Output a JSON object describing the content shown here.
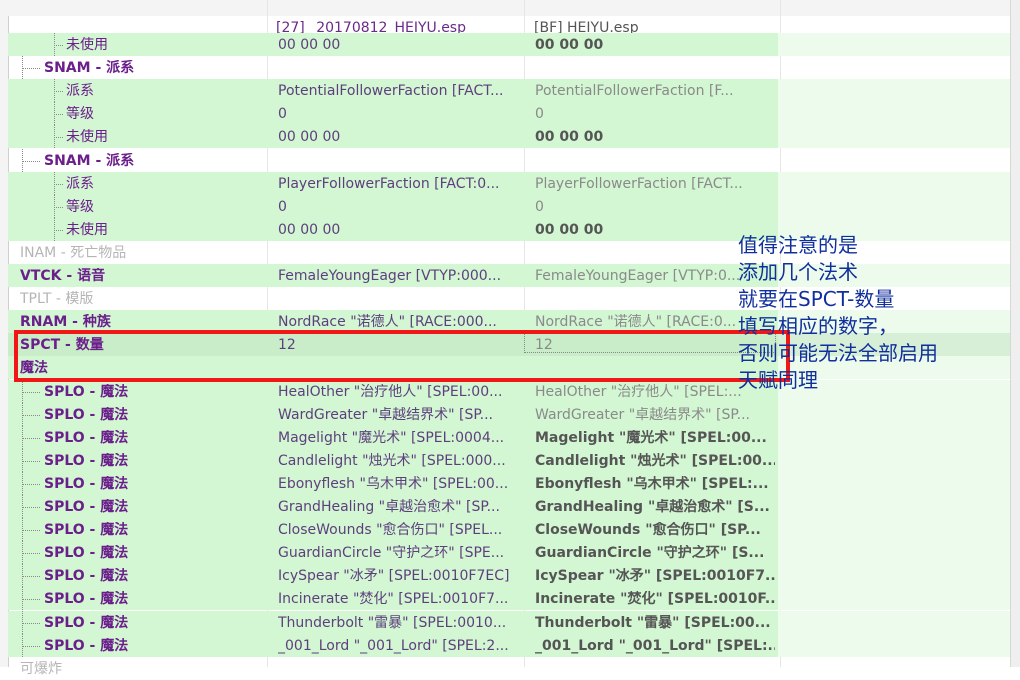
{
  "header": {
    "col1": "[27] _20170812_HEIYU.esp",
    "col2": "[BF] HEIYU.esp"
  },
  "rows": [
    {
      "type": "sub",
      "label": "未使用",
      "v1": "00 00 00",
      "v2": "00 00 00",
      "v2style": "v2b",
      "green": true
    },
    {
      "type": "name",
      "label": "SNAM - 派系",
      "v1": "",
      "v2": "",
      "green": false
    },
    {
      "type": "sub",
      "label": "派系",
      "v1": "PotentialFollowerFaction [FACT...",
      "v2": "PotentialFollowerFaction [F...",
      "v2style": "v2",
      "green": true
    },
    {
      "type": "sub",
      "label": "等级",
      "v1": "0",
      "v2": "0",
      "v2style": "v2",
      "green": true
    },
    {
      "type": "sub",
      "label": "未使用",
      "v1": "00 00 00",
      "v2": "00 00 00",
      "v2style": "v2b",
      "green": true
    },
    {
      "type": "name",
      "label": "SNAM - 派系",
      "v1": "",
      "v2": "",
      "green": false
    },
    {
      "type": "sub",
      "label": "派系",
      "v1": "PlayerFollowerFaction [FACT:0...",
      "v2": "PlayerFollowerFaction [FACT...",
      "v2style": "v2",
      "green": true
    },
    {
      "type": "sub",
      "label": "等级",
      "v1": "0",
      "v2": "0",
      "v2style": "v2",
      "green": true
    },
    {
      "type": "sub",
      "label": "未使用",
      "v1": "00 00 00",
      "v2": "00 00 00",
      "v2style": "v2b",
      "green": true
    },
    {
      "type": "dim",
      "label": "INAM - 死亡物品",
      "v1": "",
      "v2": "",
      "green": false
    },
    {
      "type": "top",
      "label": "VTCK - 语音",
      "v1": "FemaleYoungEager [VTYP:000...",
      "v2": "FemaleYoungEager [VTYP:0...",
      "v2style": "v2",
      "green": true
    },
    {
      "type": "dim",
      "label": "TPLT - 模版",
      "v1": "",
      "v2": "",
      "green": false
    },
    {
      "type": "top",
      "label": "RNAM - 种族",
      "v1": "NordRace \"诺德人\" [RACE:000...",
      "v2": "NordRace \"诺德人\" [RACE:0...",
      "v2style": "v2",
      "green": true
    },
    {
      "type": "top",
      "label": "SPCT - 数量",
      "v1": "12",
      "v2": "12",
      "v2style": "v2",
      "green": true,
      "spct": true
    },
    {
      "type": "top",
      "label": "魔法",
      "v1": "",
      "v2": "",
      "green": true
    },
    {
      "type": "name",
      "label": "SPLO - 魔法",
      "v1": "HealOther \"治疗他人\" [SPEL:00...",
      "v2": "HealOther \"治疗他人\" [SPEL:...",
      "v2style": "v2",
      "green": true
    },
    {
      "type": "name",
      "label": "SPLO - 魔法",
      "v1": "WardGreater \"卓越结界术\" [SP...",
      "v2": "WardGreater \"卓越结界术\" [SP...",
      "v2style": "v2",
      "green": true
    },
    {
      "type": "name",
      "label": "SPLO - 魔法",
      "v1": "Magelight \"魔光术\" [SPEL:0004...",
      "v2": "Magelight \"魔光术\" [SPEL:00...",
      "v2style": "v2b",
      "green": true
    },
    {
      "type": "name",
      "label": "SPLO - 魔法",
      "v1": "Candlelight \"烛光术\" [SPEL:000...",
      "v2": "Candlelight \"烛光术\" [SPEL:00...",
      "v2style": "v2b",
      "green": true
    },
    {
      "type": "name",
      "label": "SPLO - 魔法",
      "v1": "Ebonyflesh \"乌木甲术\" [SPEL:00...",
      "v2": "Ebonyflesh \"乌木甲术\" [SPEL:...",
      "v2style": "v2b",
      "green": true
    },
    {
      "type": "name",
      "label": "SPLO - 魔法",
      "v1": "GrandHealing \"卓越治愈术\" [SP...",
      "v2": "GrandHealing \"卓越治愈术\" [S...",
      "v2style": "v2b",
      "green": true
    },
    {
      "type": "name",
      "label": "SPLO - 魔法",
      "v1": "CloseWounds \"愈合伤口\" [SPEL...",
      "v2": "CloseWounds \"愈合伤口\" [SP...",
      "v2style": "v2b",
      "green": true
    },
    {
      "type": "name",
      "label": "SPLO - 魔法",
      "v1": "GuardianCircle \"守护之环\" [SPE...",
      "v2": "GuardianCircle \"守护之环\" [S...",
      "v2style": "v2b",
      "green": true
    },
    {
      "type": "name",
      "label": "SPLO - 魔法",
      "v1": "IcySpear \"冰矛\" [SPEL:0010F7EC]",
      "v2": "IcySpear \"冰矛\" [SPEL:0010F7...",
      "v2style": "v2b",
      "green": true
    },
    {
      "type": "name",
      "label": "SPLO - 魔法",
      "v1": "Incinerate \"焚化\" [SPEL:0010F7...",
      "v2": "Incinerate \"焚化\" [SPEL:0010F...",
      "v2style": "v2b",
      "green": true
    },
    {
      "type": "name",
      "label": "SPLO - 魔法",
      "v1": "Thunderbolt \"雷暴\" [SPEL:0010...",
      "v2": "Thunderbolt \"雷暴\" [SPEL:00...",
      "v2style": "v2b",
      "green": true
    },
    {
      "type": "name",
      "label": "SPLO - 魔法",
      "v1": "_001_Lord \"_001_Lord\" [SPEL:2...",
      "v2": "_001_Lord \"_001_Lord\" [SPEL:...",
      "v2style": "v2b",
      "green": true
    },
    {
      "type": "dim",
      "label": "可爆炸",
      "v1": "",
      "v2": "",
      "green": false
    }
  ],
  "annotation": {
    "lines": [
      "值得注意的是",
      "添加几个法术",
      "就要在SPCT-数量",
      "填写相应的数字，",
      "否则可能无法全部启用",
      "天赋同理"
    ]
  }
}
